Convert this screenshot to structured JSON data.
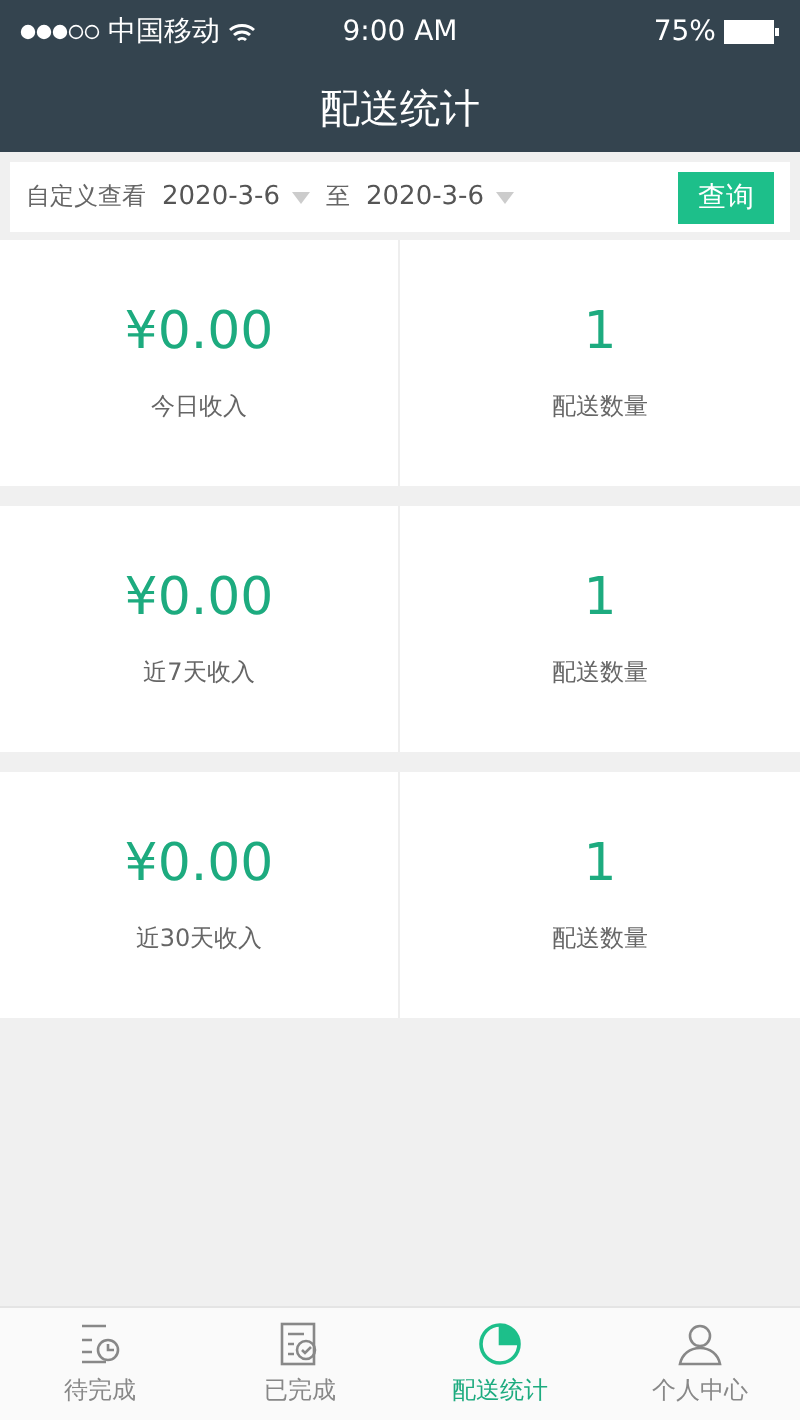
{
  "status_bar": {
    "carrier": "中国移动",
    "time": "9:00 AM",
    "battery": "75%"
  },
  "header": {
    "title": "配送统计"
  },
  "filter": {
    "label": "自定义查看",
    "from": "2020-3-6",
    "separator": "至",
    "to": "2020-3-6",
    "button": "查询"
  },
  "stats": [
    {
      "amount": "¥0.00",
      "amount_label": "今日收入",
      "count": "1",
      "count_label": "配送数量"
    },
    {
      "amount": "¥0.00",
      "amount_label": "近7天收入",
      "count": "1",
      "count_label": "配送数量"
    },
    {
      "amount": "¥0.00",
      "amount_label": "近30天收入",
      "count": "1",
      "count_label": "配送数量"
    }
  ],
  "tab_bar": [
    {
      "kind": "pending",
      "label": "待完成",
      "selected": false
    },
    {
      "kind": "done",
      "label": "已完成",
      "selected": false
    },
    {
      "kind": "stats",
      "label": "配送统计",
      "selected": true
    },
    {
      "kind": "profile",
      "label": "个人中心",
      "selected": false
    }
  ]
}
